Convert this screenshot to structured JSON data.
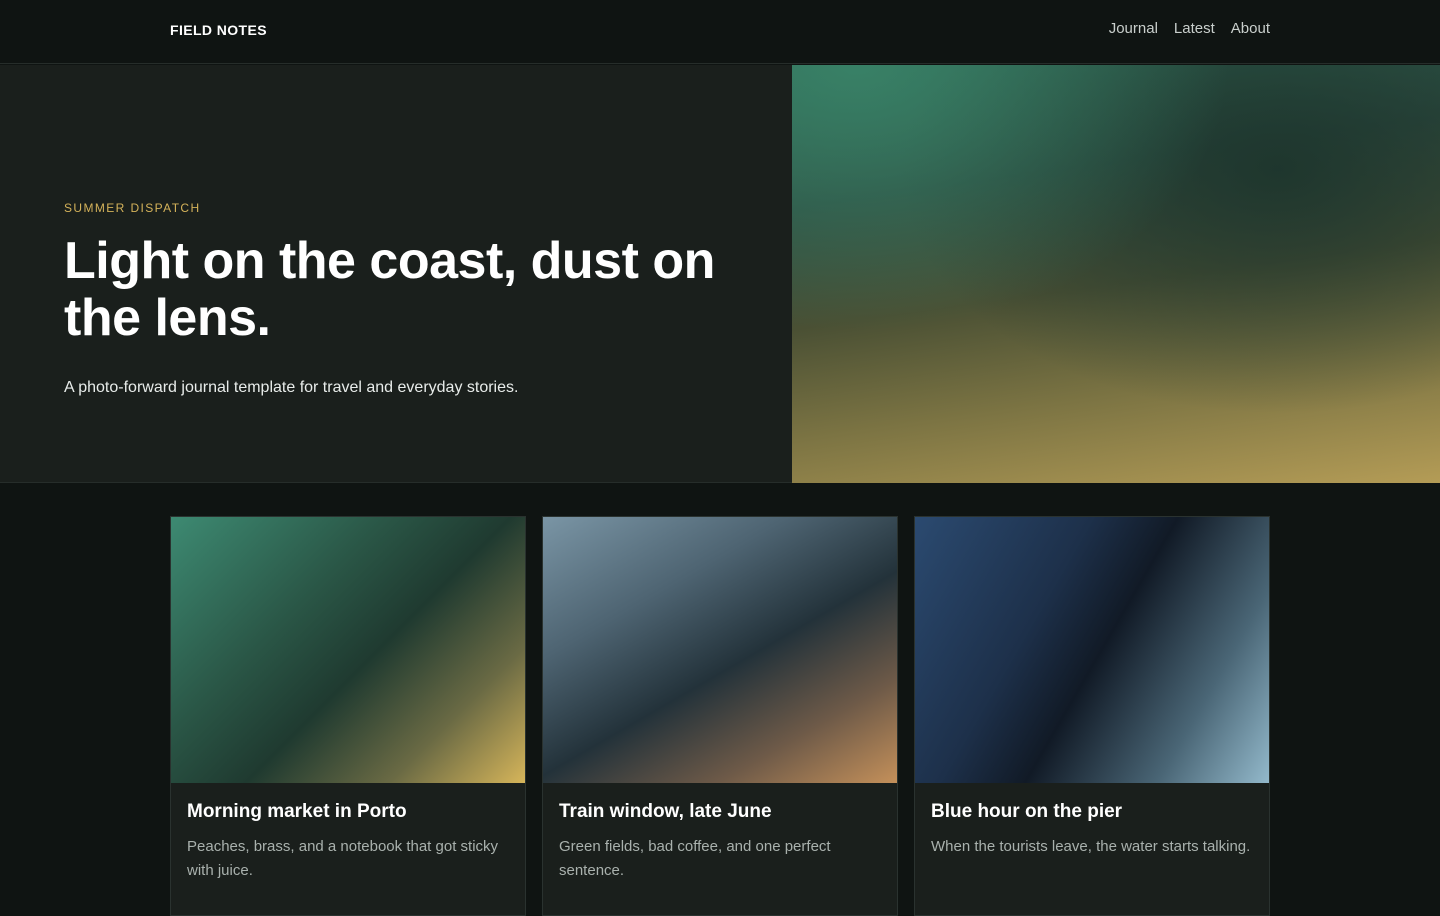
{
  "header": {
    "brand": "FIELD NOTES",
    "nav": [
      {
        "label": "Journal"
      },
      {
        "label": "Latest"
      },
      {
        "label": "About"
      }
    ]
  },
  "hero": {
    "eyebrow": "SUMMER DISPATCH",
    "headline": "Light on the coast, dust on the lens.",
    "subline": "A photo-forward journal template for travel and everyday stories."
  },
  "cards": [
    {
      "title": "Morning market in Porto",
      "description": "Peaches, brass, and a notebook that got sticky with juice."
    },
    {
      "title": "Train window, late June",
      "description": "Green fields, bad coffee, and one perfect sentence."
    },
    {
      "title": "Blue hour on the pier",
      "description": "When the tourists leave, the water starts talking."
    }
  ],
  "colors": {
    "background": "#0f1412",
    "panel": "#1a1f1c",
    "accent": "#d4b25a"
  }
}
